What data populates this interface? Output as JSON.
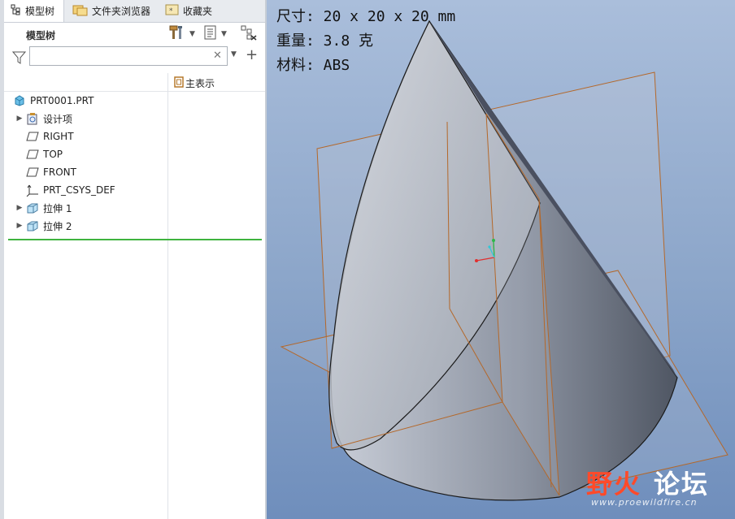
{
  "tabs": [
    {
      "label": "模型树"
    },
    {
      "label": "文件夹浏览器"
    },
    {
      "label": "收藏夹"
    }
  ],
  "tree": {
    "title": "模型树",
    "filter_value": "",
    "column_main": "主表示",
    "items": [
      {
        "label": "PRT0001.PRT"
      },
      {
        "label": "设计项"
      },
      {
        "label": "RIGHT"
      },
      {
        "label": "TOP"
      },
      {
        "label": "FRONT"
      },
      {
        "label": "PRT_CSYS_DEF"
      },
      {
        "label": "拉伸 1"
      },
      {
        "label": "拉伸 2"
      }
    ]
  },
  "viewport": {
    "props": [
      {
        "text": "尺寸: 20 x 20 x 20 mm"
      },
      {
        "text": "重量: 3.8 克"
      },
      {
        "text": "材料: ABS"
      }
    ],
    "watermark": {
      "part1": "野火",
      "part2": "论坛",
      "url": "www.proewildfire.cn"
    }
  },
  "colors": {
    "datum_plane": "#b4682a",
    "insert_line": "#3fb33f",
    "watermark": "#ff4a2a"
  }
}
